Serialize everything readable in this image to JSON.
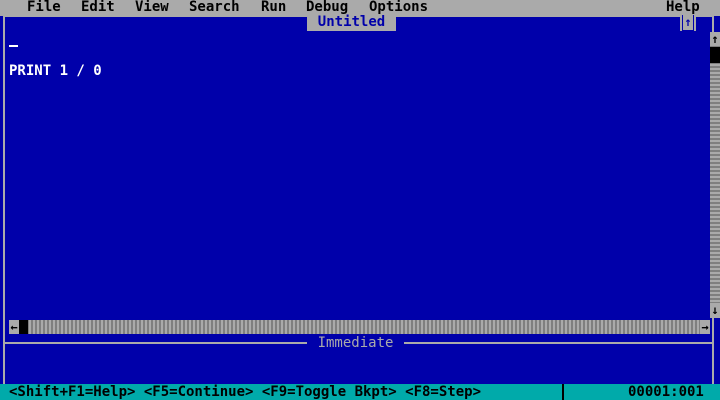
{
  "menubar": {
    "items": [
      {
        "label": "File"
      },
      {
        "label": "Edit"
      },
      {
        "label": "View"
      },
      {
        "label": "Search"
      },
      {
        "label": "Run"
      },
      {
        "label": "Debug"
      },
      {
        "label": "Options"
      }
    ],
    "help_label": "Help"
  },
  "editor": {
    "title": "Untitled",
    "code_lines": [
      "PRINT 1 / 0"
    ],
    "maximize_icon": "up-arrow",
    "scroll_up_glyph": "↑",
    "scroll_down_glyph": "↓",
    "scroll_left_glyph": "←",
    "scroll_right_glyph": "→",
    "maximize_glyph": "↑"
  },
  "immediate": {
    "title": "Immediate"
  },
  "statusbar": {
    "hints": "<Shift+F1=Help> <F5=Continue> <F9=Toggle Bkpt> <F8=Step>",
    "position": "00001:001"
  },
  "colors": {
    "background": "#0000aa",
    "menu_bg": "#aaaaaa",
    "status_bg": "#00aaaa",
    "text": "#ffffff"
  }
}
